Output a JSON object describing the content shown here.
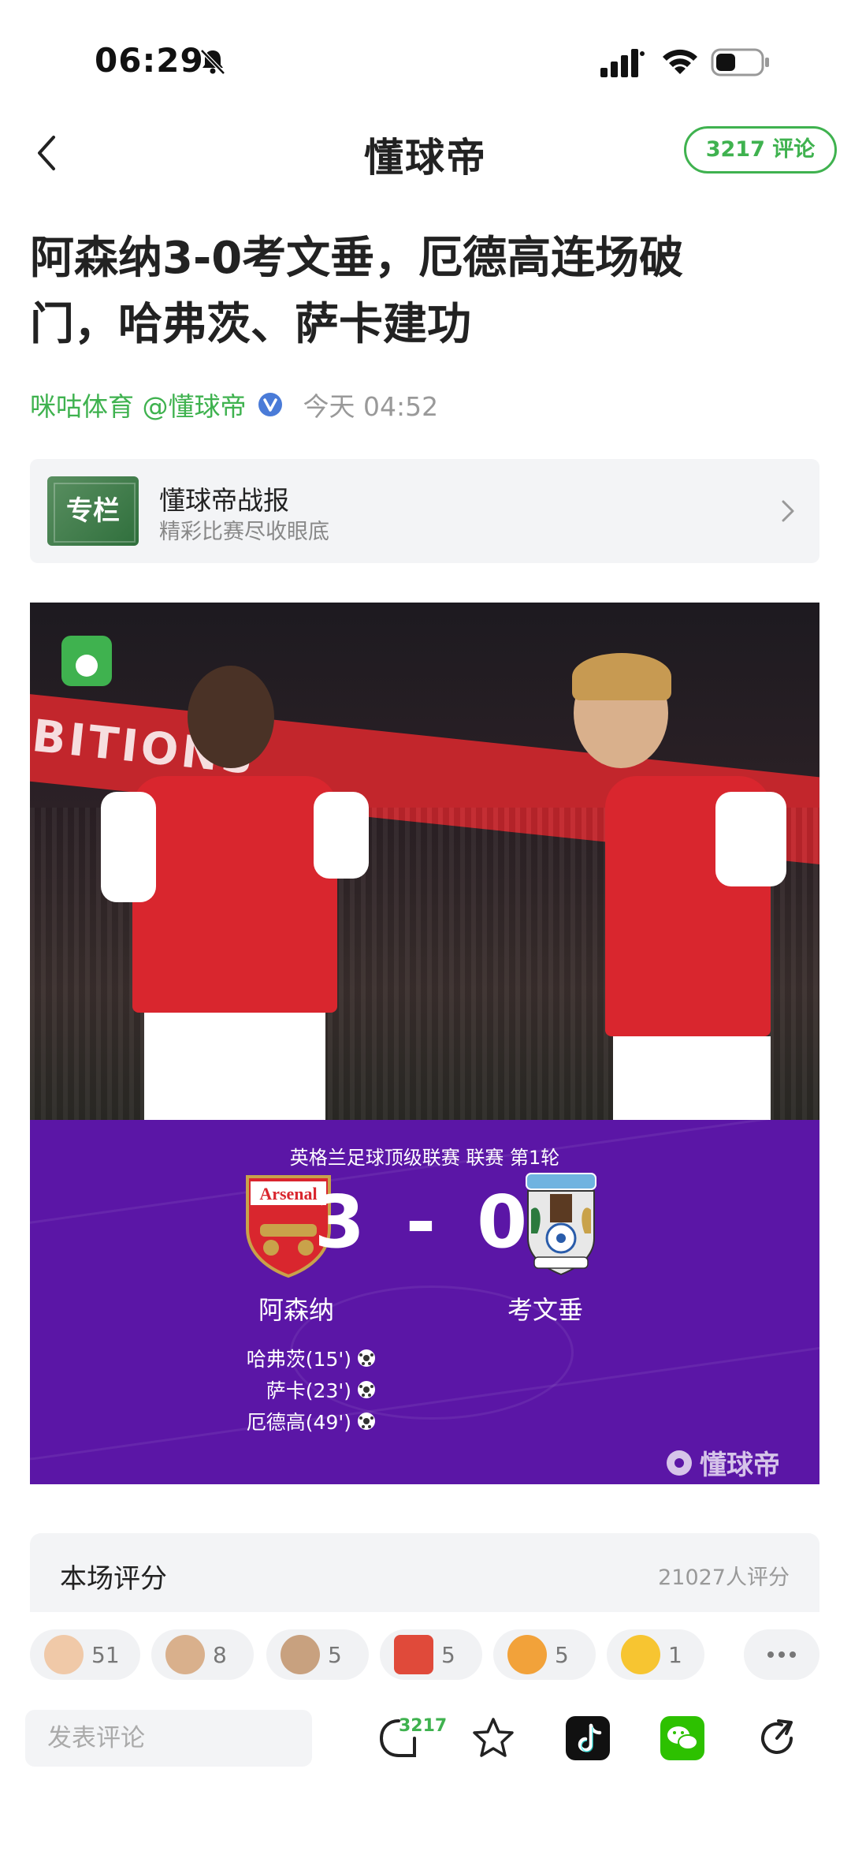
{
  "status_bar": {
    "time": "06:29"
  },
  "nav": {
    "brand": "懂球帝",
    "comment_pill": "3217 评论"
  },
  "article": {
    "title_line1": "阿森纳3-0考文垂，厄德高连场破",
    "title_line2": "门，哈弗茨、萨卡建功",
    "source": "咪咕体育 @懂球帝",
    "time": "今天 04:52"
  },
  "column": {
    "thumb_label": "专栏",
    "title": "懂球帝战报",
    "subtitle": "精彩比赛尽收眼底"
  },
  "match": {
    "banner_text": "BITIONS",
    "league": "英格兰足球顶级联赛 联赛 第1轮",
    "score": "3 - 0",
    "home_team": "阿森纳",
    "away_team": "考文垂",
    "home_crest_text": "Arsenal",
    "scorers": [
      {
        "text": "哈弗茨(15')"
      },
      {
        "text": "萨卡(23')"
      },
      {
        "text": "厄德高(49')"
      }
    ],
    "watermark": "懂球帝"
  },
  "rating": {
    "title": "本场评分",
    "count": "21027人评分"
  },
  "reactions": [
    {
      "count": "51",
      "color": "#f0c9a8"
    },
    {
      "count": "8",
      "color": "#d9b08c"
    },
    {
      "count": "5",
      "color": "#c8a17f"
    },
    {
      "count": "5",
      "color": "#e04a3a"
    },
    {
      "count": "5",
      "color": "#f2a23a"
    },
    {
      "count": "1",
      "color": "#f7c531"
    }
  ],
  "bottom_bar": {
    "input_placeholder": "发表评论",
    "comment_count": "3217"
  },
  "colors": {
    "accent": "#3fb24f",
    "match_purple": "#5b16a6",
    "arsenal_red": "#d9262e"
  }
}
